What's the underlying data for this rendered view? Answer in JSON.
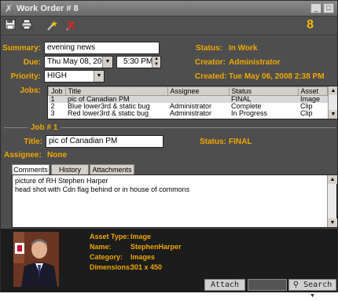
{
  "window": {
    "title": "Work Order # 8",
    "count": "8"
  },
  "form": {
    "summary_label": "Summary:",
    "summary_value": "evening news",
    "due_label": "Due:",
    "due_date": "Thu May 08, 2008",
    "due_time": "5:30 PM",
    "priority_label": "Priority:",
    "priority_value": "HIGH",
    "jobs_label": "Jobs:",
    "status_label": "Status:",
    "status_value": "In Work",
    "creator_label": "Creator:",
    "creator_value": "Administrator",
    "created_label": "Created:",
    "created_value": "Tue May 06, 2008 2:38 PM"
  },
  "jobs_table": {
    "columns": [
      "Job",
      "Title",
      "Assignee",
      "Status",
      "Asset"
    ],
    "rows": [
      [
        "1",
        "pic of Canadian PM",
        "",
        "FINAL",
        "Image"
      ],
      [
        "2",
        "Blue lower3rd & static bug",
        "Administrator",
        "Complete",
        "Clip"
      ],
      [
        "3",
        "Red lower3rd & static bug",
        "Administrator",
        "In Progress",
        "Clip"
      ]
    ]
  },
  "job_detail": {
    "header": "Job # 1",
    "title_label": "Title:",
    "title_value": "pic of Canadian PM",
    "status_label": "Status:",
    "status_value": "FINAL",
    "assignee_label": "Assignee:",
    "assignee_value": "None"
  },
  "tabs": [
    "Comments",
    "History",
    "Attachments"
  ],
  "comments": {
    "line1": "picture of RH Stephen Harper",
    "line2": "head shot with Cdn flag behind or in house of commons"
  },
  "asset": {
    "type_label": "Asset Type:",
    "type_value": "Image",
    "name_label": "Name:",
    "name_value": "StephenHarper",
    "category_label": "Category:",
    "category_value": "Images",
    "dimensions_label": "Dimensions:",
    "dimensions_value": "301 x 450"
  },
  "buttons": {
    "attach": "Attach",
    "search": "Search"
  },
  "colors": {
    "accent": "#f0a800",
    "panel": "#4e4e4e"
  }
}
